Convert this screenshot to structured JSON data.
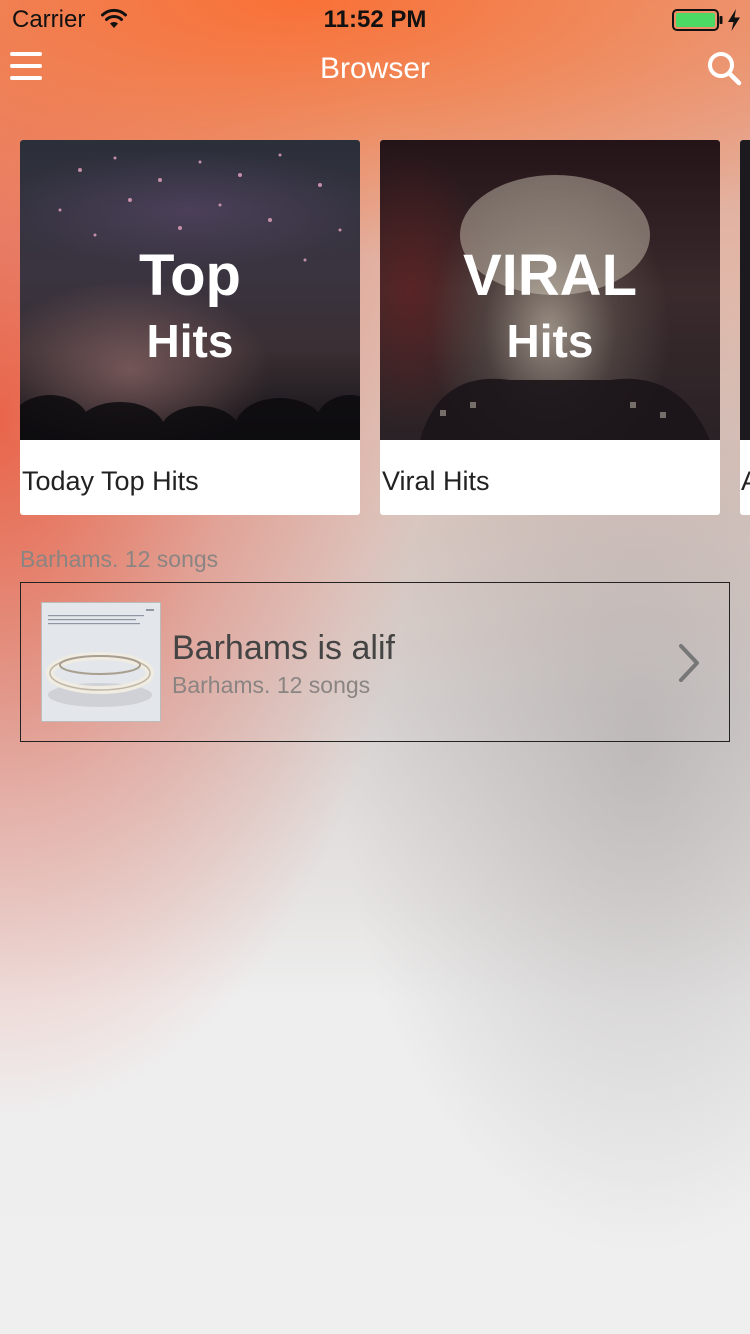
{
  "status_bar": {
    "carrier": "Carrier",
    "time": "11:52 PM",
    "battery_icon": "battery-full-icon",
    "wifi_icon": "wifi-icon",
    "charging_icon": "charging-bolt-icon"
  },
  "nav": {
    "title": "Browser",
    "menu_icon": "hamburger-menu-icon",
    "search_icon": "search-icon"
  },
  "playlists": [
    {
      "art_line1": "Top",
      "art_line2": "Hits",
      "title": "Today Top Hits"
    },
    {
      "art_line1": "VIRAL",
      "art_line2": "Hits",
      "title": "Viral Hits"
    },
    {
      "title": "A"
    }
  ],
  "section": {
    "header": "Barhams. 12 songs",
    "albums": [
      {
        "title": "Barhams is alif",
        "subtitle": "Barhams. 12 songs",
        "chevron_icon": "chevron-right-icon"
      }
    ]
  },
  "colors": {
    "nav_text": "#ffffff",
    "battery_fill": "#4cd964",
    "card_background": "#ffffff",
    "secondary_text": "#8a8482"
  }
}
